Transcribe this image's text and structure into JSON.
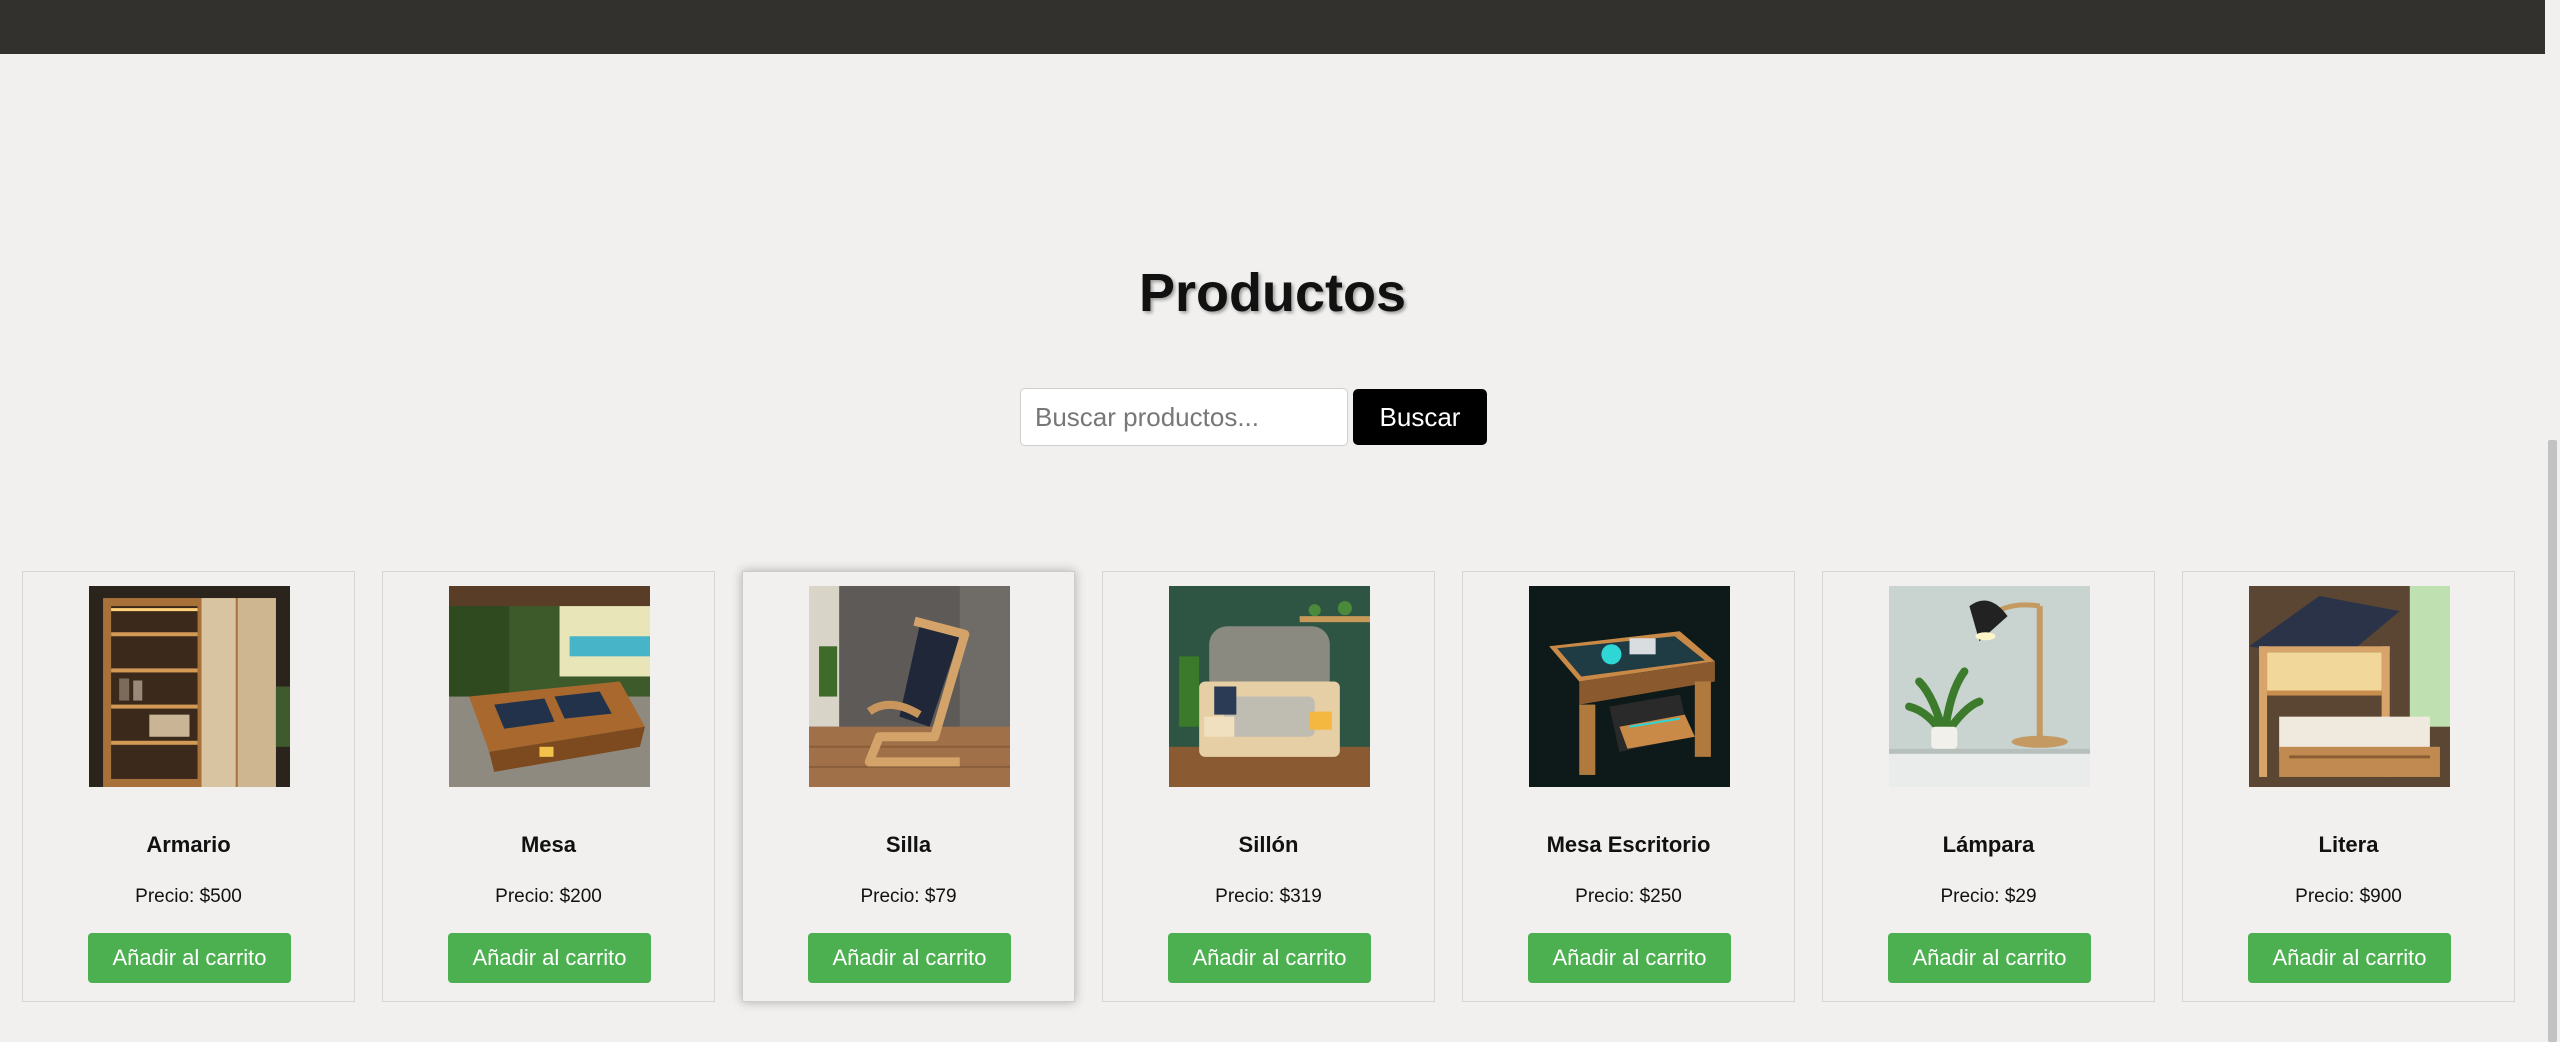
{
  "page": {
    "title": "Productos"
  },
  "search": {
    "placeholder": "Buscar productos...",
    "button_label": "Buscar"
  },
  "products": [
    {
      "name": "Armario",
      "price": "Precio: $500",
      "button_label": "Añadir al carrito",
      "image_icon": "wardrobe-image"
    },
    {
      "name": "Mesa",
      "price": "Precio: $200",
      "button_label": "Añadir al carrito",
      "image_icon": "table-image"
    },
    {
      "name": "Silla",
      "price": "Precio: $79",
      "button_label": "Añadir al carrito",
      "image_icon": "chair-image"
    },
    {
      "name": "Sillón",
      "price": "Precio: $319",
      "button_label": "Añadir al carrito",
      "image_icon": "armchair-image"
    },
    {
      "name": "Mesa Escritorio",
      "price": "Precio: $250",
      "button_label": "Añadir al carrito",
      "image_icon": "desk-image"
    },
    {
      "name": "Lámpara",
      "price": "Precio: $29",
      "button_label": "Añadir al carrito",
      "image_icon": "lamp-image"
    },
    {
      "name": "Litera",
      "price": "Precio: $900",
      "button_label": "Añadir al carrito",
      "image_icon": "bunk-bed-image"
    }
  ],
  "colors": {
    "header": "#32312d",
    "background": "#f1f0ee",
    "accent_green": "#4caf50",
    "search_button": "#000000"
  }
}
